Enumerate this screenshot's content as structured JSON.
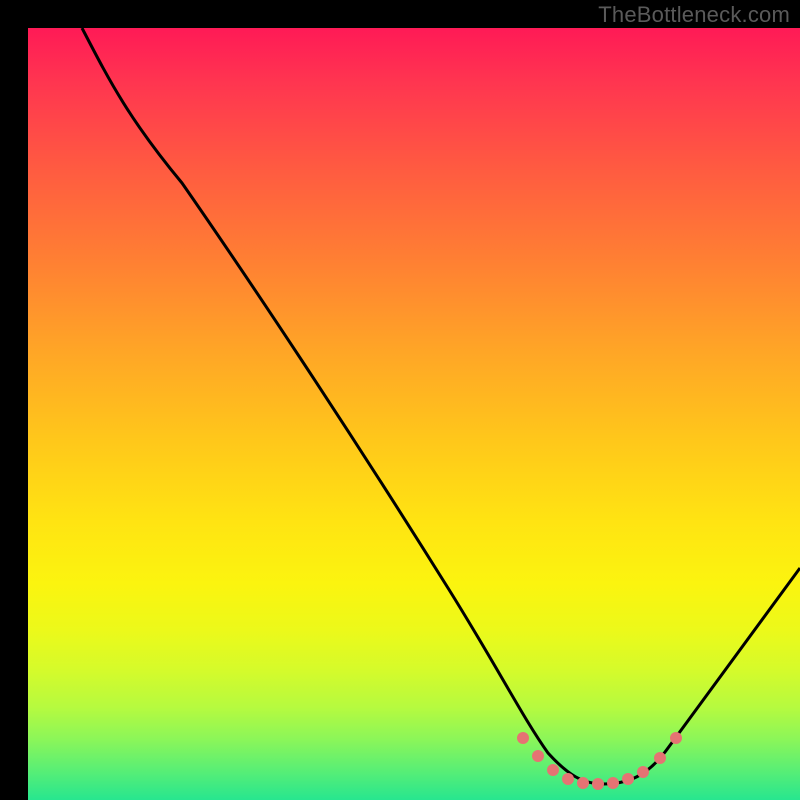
{
  "watermark": "TheBottleneck.com",
  "chart_data": {
    "type": "line",
    "title": "",
    "xlabel": "",
    "ylabel": "",
    "xlim": [
      0,
      100
    ],
    "ylim": [
      0,
      100
    ],
    "series": [
      {
        "name": "bottleneck-curve",
        "x": [
          7,
          12,
          20,
          30,
          40,
          50,
          60,
          64,
          67,
          70,
          72,
          74,
          76,
          78,
          80,
          82,
          85,
          90,
          95,
          100
        ],
        "values": [
          100,
          92,
          80,
          65,
          51,
          36,
          21,
          14,
          10,
          6,
          4,
          3,
          2,
          2,
          3,
          4,
          7,
          14,
          22,
          30
        ]
      },
      {
        "name": "sweet-spot-markers",
        "x": [
          64,
          67,
          69,
          71,
          73,
          75,
          77,
          79,
          81,
          83
        ],
        "values": [
          10,
          6,
          5,
          4,
          3,
          2,
          2,
          3,
          4,
          6
        ]
      }
    ],
    "colors": {
      "curve": "#000000",
      "markers": "#e57373",
      "gradient_top": "#ff1a56",
      "gradient_bottom": "#27e68f"
    }
  }
}
